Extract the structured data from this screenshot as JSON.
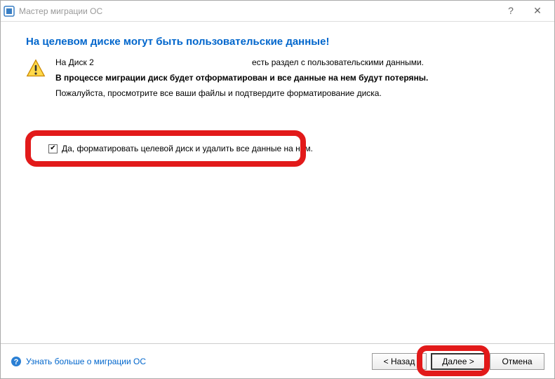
{
  "titlebar": {
    "title": "Мастер миграции ОС"
  },
  "content": {
    "heading": "На целевом диске могут быть пользовательские данные!",
    "line1_left": "На Диск 2",
    "line1_right": "есть раздел с пользовательскими данными.",
    "bold_line": "В процессе миграции диск будет отформатирован и все данные на нем будут потеряны.",
    "plain_line": "Пожалуйста, просмотрите все ваши файлы и подтвердите форматирование диска.",
    "checkbox_label": "Да, форматировать целевой диск и удалить все данные на нем."
  },
  "footer": {
    "help_link": "Узнать больше о миграции ОС",
    "back_button": "< Назад",
    "next_button": "Далее >",
    "cancel_button": "Отмена"
  }
}
